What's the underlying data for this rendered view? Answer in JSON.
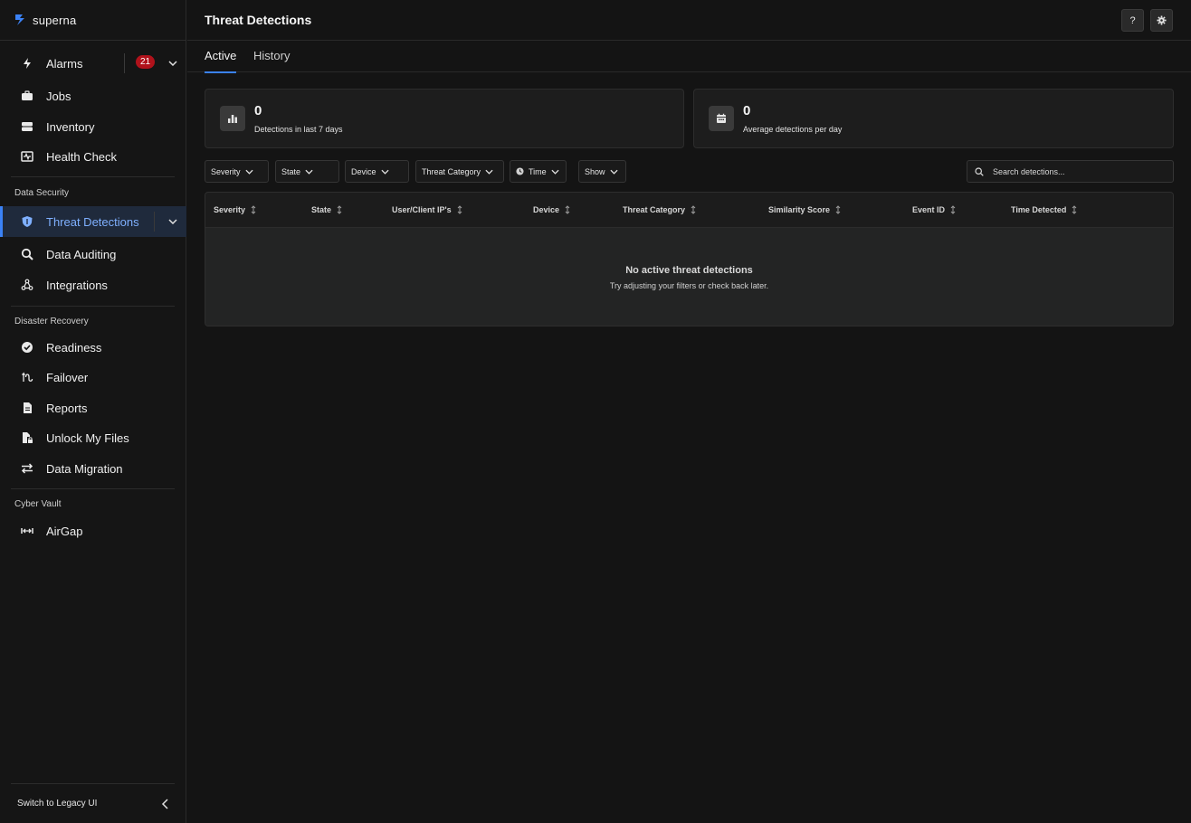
{
  "app": {
    "logo_text": "superna"
  },
  "sidebar": {
    "alarms": {
      "label": "Alarms",
      "badge": "21"
    },
    "top_items": [
      {
        "label": "Jobs"
      },
      {
        "label": "Inventory"
      },
      {
        "label": "Health Check"
      }
    ],
    "sections": {
      "data_security": "Data Security",
      "disaster_recovery": "Disaster Recovery",
      "cyber_vault": "Cyber Vault"
    },
    "data_security_items": [
      {
        "label": "Threat Detections"
      },
      {
        "label": "Data Auditing"
      },
      {
        "label": "Integrations"
      }
    ],
    "disaster_recovery_items": [
      {
        "label": "Readiness"
      },
      {
        "label": "Failover"
      },
      {
        "label": "Reports"
      },
      {
        "label": "Unlock My Files"
      },
      {
        "label": "Data Migration"
      }
    ],
    "cyber_vault_items": [
      {
        "label": "AirGap"
      }
    ],
    "legacy_label": "Switch to Legacy UI"
  },
  "header": {
    "title": "Threat Detections",
    "help_label": "?"
  },
  "tabs": [
    {
      "label": "Active"
    },
    {
      "label": "History"
    }
  ],
  "stats": [
    {
      "value": "0",
      "caption": "Detections in last 7 days"
    },
    {
      "value": "0",
      "caption": "Average detections per day"
    }
  ],
  "filters": [
    {
      "label": "Severity"
    },
    {
      "label": "State"
    },
    {
      "label": "Device"
    },
    {
      "label": "Threat Category"
    },
    {
      "label": "Time"
    },
    {
      "label": "Show"
    }
  ],
  "search": {
    "placeholder": "Search detections..."
  },
  "table": {
    "columns": [
      {
        "label": "Severity"
      },
      {
        "label": "State"
      },
      {
        "label": "User/Client IP's"
      },
      {
        "label": "Device"
      },
      {
        "label": "Threat Category"
      },
      {
        "label": "Similarity Score"
      },
      {
        "label": "Event ID"
      },
      {
        "label": "Time Detected"
      }
    ],
    "empty_title": "No active threat detections",
    "empty_subtitle": "Try adjusting your filters or check back later."
  },
  "colors": {
    "accent": "#3b82f6",
    "badge": "#b0121b",
    "background": "#141414"
  }
}
